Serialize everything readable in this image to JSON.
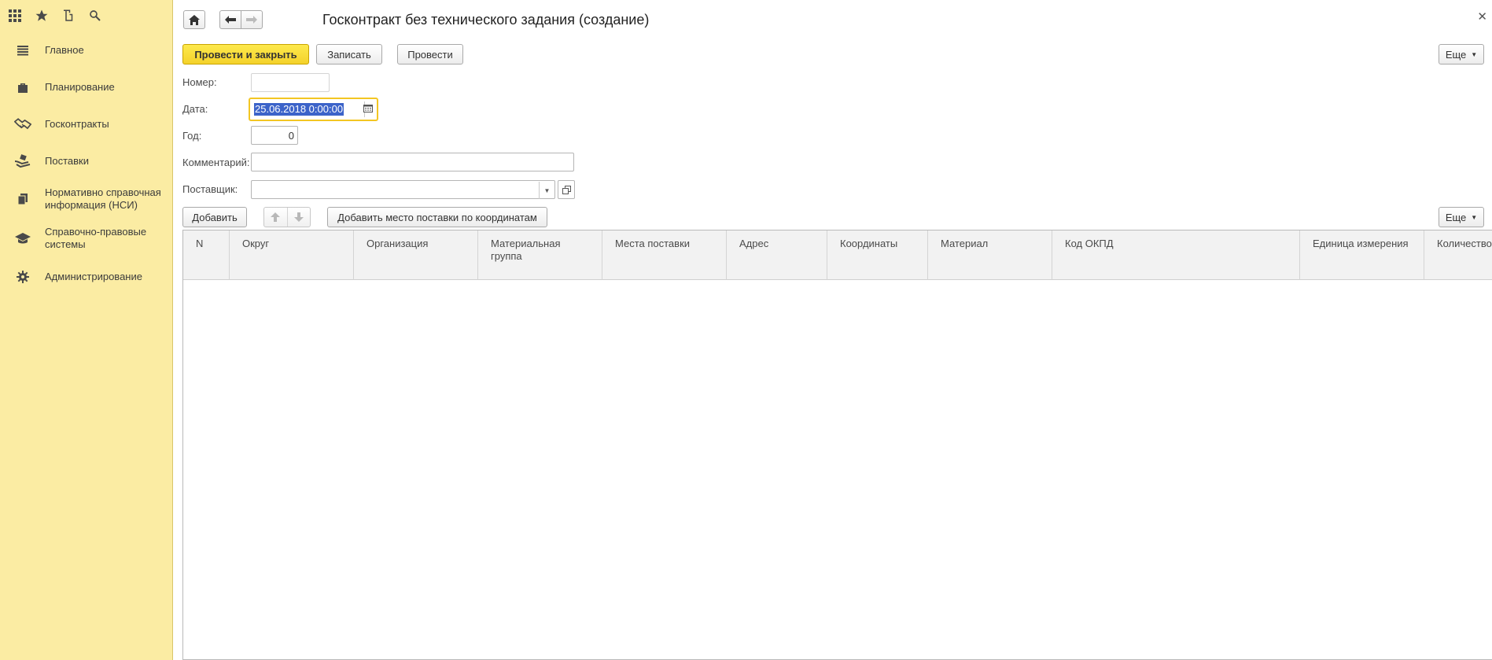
{
  "topbar": {
    "icons": [
      "apps-grid-icon",
      "star-icon",
      "history-icon",
      "search-icon"
    ]
  },
  "sidebar": {
    "items": [
      {
        "label": "Главное",
        "icon": "menu-lines-icon"
      },
      {
        "label": "Планирование",
        "icon": "briefcase-icon"
      },
      {
        "label": "Госконтракты",
        "icon": "handshake-icon"
      },
      {
        "label": "Поставки",
        "icon": "delivery-hand-icon"
      },
      {
        "label": "Нормативно справочная информация (НСИ)",
        "icon": "documents-icon"
      },
      {
        "label": "Справочно-правовые системы",
        "icon": "graduation-cap-icon"
      },
      {
        "label": "Администрирование",
        "icon": "gear-icon"
      }
    ]
  },
  "header": {
    "title": "Госконтракт без технического задания (создание)"
  },
  "toolbar": {
    "post_and_close": "Провести и закрыть",
    "save": "Записать",
    "post": "Провести",
    "more": "Еще"
  },
  "form": {
    "number_label": "Номер:",
    "number_value": "",
    "date_label": "Дата:",
    "date_value": "25.06.2018  0:00:00",
    "year_label": "Год:",
    "year_value": "0",
    "comment_label": "Комментарий:",
    "comment_value": "",
    "supplier_label": "Поставщик:",
    "supplier_value": ""
  },
  "table_toolbar": {
    "add": "Добавить",
    "add_by_coords": "Добавить место поставки по координатам",
    "more": "Еще"
  },
  "table": {
    "columns": [
      "N",
      "Округ",
      "Организация",
      "Материальная группа",
      "Места поставки",
      "Адрес",
      "Координаты",
      "Материал",
      "Код ОКПД",
      "Единица измерения",
      "Количество"
    ],
    "rows": []
  },
  "colors": {
    "sidebar_bg": "#fbeca3",
    "primary_button": "#f4d22b",
    "focus_border": "#f3c623",
    "selection": "#3c63c9"
  }
}
